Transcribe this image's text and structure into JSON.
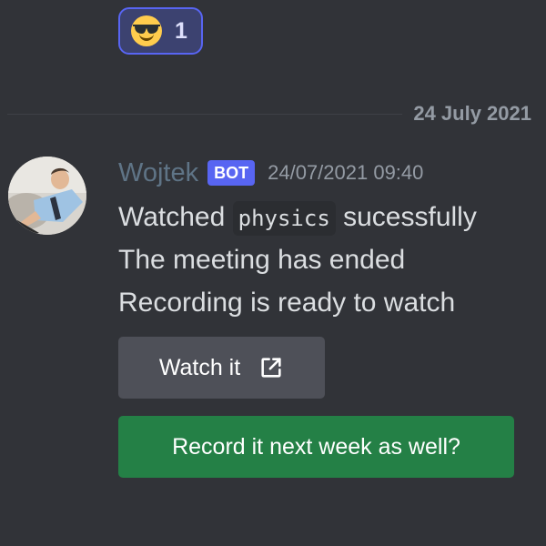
{
  "reaction": {
    "emoji": "smiling-face-with-sunglasses",
    "count": "1"
  },
  "divider": {
    "date": "24 July 2021"
  },
  "message": {
    "username": "Wojtek",
    "bot_tag": "BOT",
    "timestamp": "24/07/2021 09:40",
    "line1_pre": "Watched ",
    "line1_code": "physics",
    "line1_post": " sucessfully",
    "line2": "The meeting has ended",
    "line3": "Recording is ready to watch"
  },
  "buttons": {
    "watch_label": "Watch it",
    "watch_icon": "external-link-icon",
    "record_label": "Record it next week as well?"
  },
  "colors": {
    "background": "#313338",
    "bot_tag": "#5865f2",
    "record_button": "#248046",
    "watch_button": "#4e5058",
    "username": "#5f7486"
  }
}
